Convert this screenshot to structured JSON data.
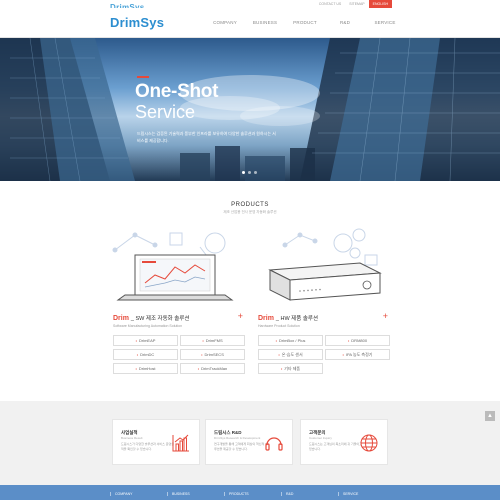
{
  "brand": {
    "top_logo": "DrimSys",
    "logo": "DrimSys"
  },
  "utility": [
    "CONTACT US",
    "SITEMAP",
    "ENGLISH"
  ],
  "nav": [
    "COMPANY",
    "BUSINESS",
    "PRODUCT",
    "R&D",
    "SERVICE"
  ],
  "hero": {
    "title": "One-Shot",
    "subtitle": "Service",
    "description": "드림시스는 검증된 기술력과 풍부한 인프라를 보유하여 다양한 솔루션과 원하시는 서비스를 제공합니다."
  },
  "products": {
    "title": "PRODUCTS",
    "subtitle": "제조 산업용 전사 운영 자동화 솔루션",
    "sw": {
      "brand": "Drim",
      "name": "_ SW 제조 자동화 솔루션",
      "english": "Software Manufacturing Automation Solution",
      "items": [
        "DrimEAP",
        "DrimFMS",
        "DrimDC",
        "DrimSECS",
        "DrimHost",
        "DrimTrackMan"
      ]
    },
    "hw": {
      "brand": "Drim",
      "name": "_ HW 제품 솔루션",
      "english": "Hardware Product Solution",
      "items": [
        "DrimBox / Plus",
        "DRM800",
        "온·습도 센서",
        "IPA 농도 측정기",
        "기타 제품"
      ]
    }
  },
  "info": [
    {
      "title": "사업실적",
      "english": "Business Result",
      "description": "드림시스가 다양한 솔루션과 서비스 운영실적을 확인할 수 있습니다."
    },
    {
      "title": "드림시스 R&D",
      "english": "DrimSys Research & Development",
      "description": "연구개발을 통해 고객에게 최상의 혁신적 솔루션을 제공할 수 있습니다."
    },
    {
      "title": "고객문의",
      "english": "Customer Inquiry",
      "description": "드림시스는 고객님의 목소리에 귀 기울이고 있습니다."
    }
  ],
  "footer": [
    "COMPANY",
    "BUSINESS",
    "PRODUCTS",
    "R&D",
    "SERVICE"
  ],
  "colors": {
    "accent": "#e64a3b",
    "brand": "#2c8ed0",
    "footer": "#5b8ec8"
  },
  "icons": {
    "top_button": "arrow-up-icon"
  }
}
